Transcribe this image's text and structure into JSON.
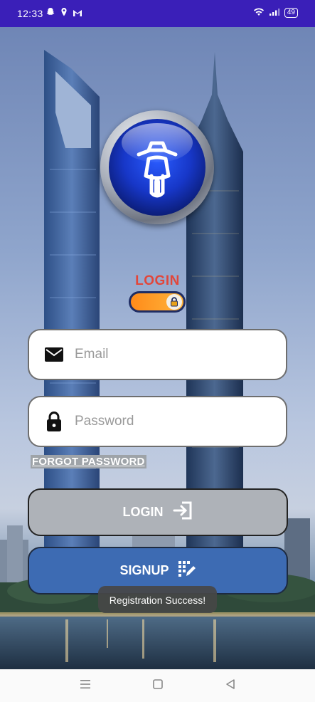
{
  "status_bar": {
    "time": "12:33",
    "battery": "49",
    "background_color": "#3a1fb8"
  },
  "app": {
    "logo_icon": "motorcycle-logo-icon",
    "login_heading": "LOGIN",
    "lock_toggle_icon": "lock-icon"
  },
  "form": {
    "email": {
      "placeholder": "Email",
      "value": "",
      "icon": "mail-icon"
    },
    "password": {
      "placeholder": "Password",
      "value": "",
      "icon": "lock-icon"
    },
    "forgot_password": "FORGOT PASSWORD"
  },
  "buttons": {
    "login": {
      "label": "LOGIN",
      "icon": "login-arrow-icon",
      "color": "#aeb2b8"
    },
    "signup": {
      "label": "SIGNUP",
      "icon": "signup-pen-icon",
      "color": "#3d6bb3"
    }
  },
  "toast": "Registration Success!",
  "nav_bar": {
    "icons": [
      "menu-icon",
      "home-square-icon",
      "back-triangle-icon"
    ]
  }
}
